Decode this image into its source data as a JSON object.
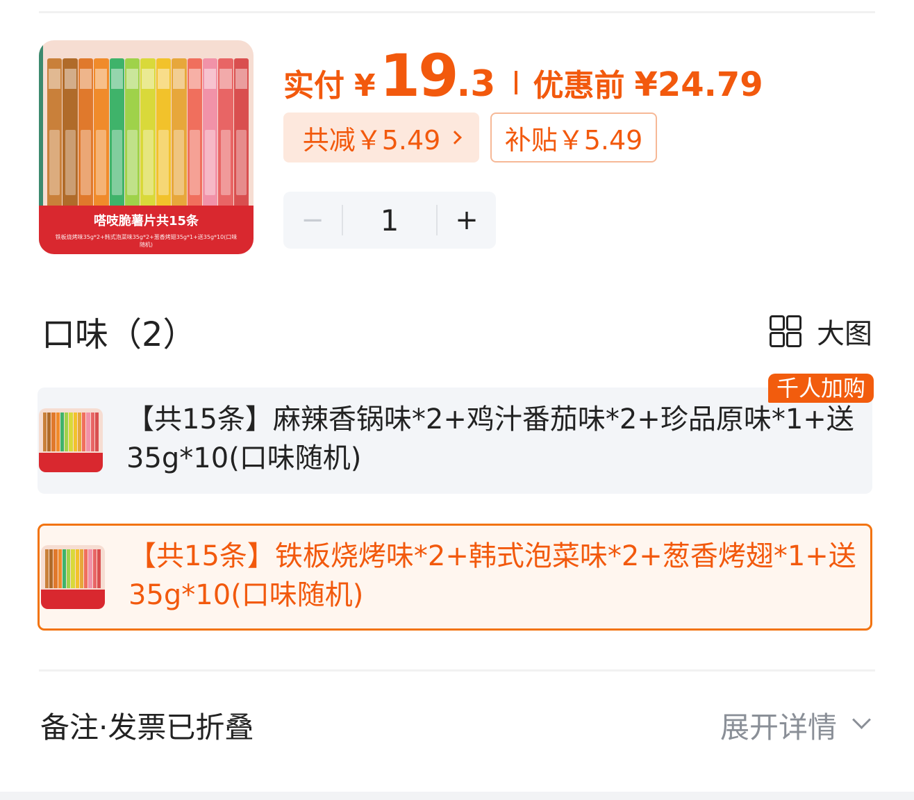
{
  "product": {
    "image_banner_title": "嗒吱脆薯片共15条",
    "image_banner_sub": "铁板烧烤味35g*2+韩式泡菜味35g*2+葱香烤翅35g*1+送35g*10(口味随机)",
    "stick_colors": [
      "#c9803a",
      "#b06b2a",
      "#e0792c",
      "#f08b2b",
      "#3fb36a",
      "#9fd24a",
      "#d9d93a",
      "#f2c22b",
      "#e7a73b",
      "#f06f5d",
      "#f192a8",
      "#e86565",
      "#d94f4f"
    ]
  },
  "price": {
    "label": "实付",
    "currency": "¥",
    "integer": "19",
    "decimal": ".3",
    "pre_label": "优惠前",
    "pre_value": "¥24.79"
  },
  "discounts": {
    "total": "共减￥5.49",
    "subsidy": "补贴￥5.49"
  },
  "stepper": {
    "minus": "−",
    "value": "1",
    "plus": "+"
  },
  "flavor_section": {
    "title": "口味（2）",
    "big_view_label": "大图"
  },
  "options": [
    {
      "text": "【共15条】麻辣香锅味*2+鸡汁番茄味*2+珍品原味*1+送35g*10(口味随机)",
      "badge": "千人加购",
      "selected": false
    },
    {
      "text": "【共15条】铁板烧烤味*2+韩式泡菜味*2+葱香烤翅*1+送35g*10(口味随机)",
      "selected": true
    }
  ],
  "notes": {
    "label": "备注·发票已折叠",
    "expand": "展开详情"
  },
  "colors": {
    "accent": "#f2590d",
    "selected_border": "#f2730f"
  }
}
